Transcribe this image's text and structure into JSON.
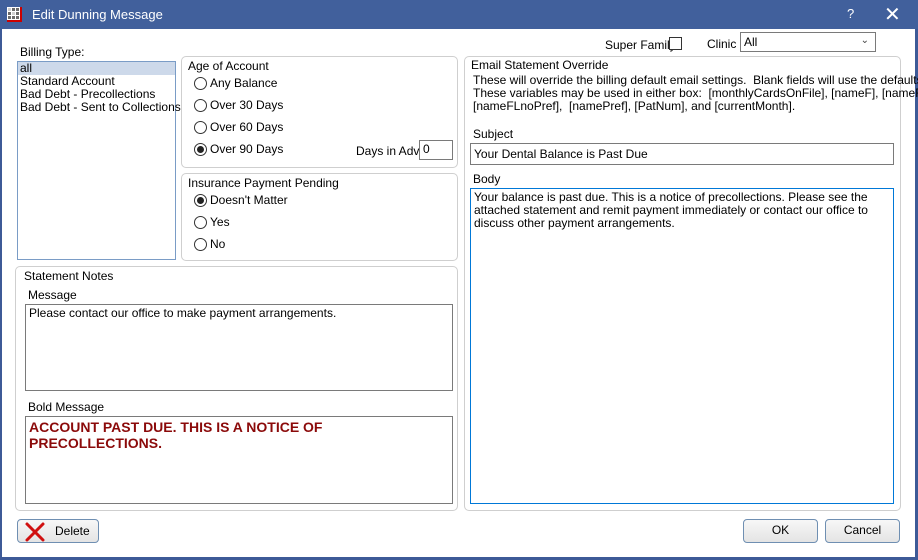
{
  "window": {
    "title": "Edit Dunning Message",
    "help_label": "?",
    "close_label": "✕"
  },
  "billing_type": {
    "label": "Billing Type:",
    "items": [
      "all",
      "Standard Account",
      "Bad Debt - Precollections",
      "Bad Debt - Sent to Collections"
    ],
    "selected": "all"
  },
  "age_of_account": {
    "title": "Age of Account",
    "options": [
      "Any Balance",
      "Over 30 Days",
      "Over 60 Days",
      "Over 90 Days"
    ],
    "selected": "Over 90 Days",
    "days_in_adv_label": "Days in Adv",
    "days_in_adv_value": "0"
  },
  "insurance_payment_pending": {
    "title": "Insurance Payment Pending",
    "options": [
      "Doesn't Matter",
      "Yes",
      "No"
    ],
    "selected": "Doesn't Matter"
  },
  "super_family": {
    "label": "Super Family",
    "checked": false
  },
  "clinic": {
    "label": "Clinic",
    "value": "All"
  },
  "email_override": {
    "title": "Email Statement Override",
    "description": "These will override the billing default email settings.  Blank fields will use the defaults.\nThese variables may be used in either box:  [monthlyCardsOnFile], [nameF], [nameFL],\n[nameFLnoPref],  [namePref], [PatNum], and [currentMonth].",
    "subject_label": "Subject",
    "subject_value": "Your Dental Balance is Past Due",
    "body_label": "Body",
    "body_value": "Your balance is past due. This is a notice of precollections. Please see the attached statement and remit payment immediately or contact our office to discuss other payment arrangements."
  },
  "statement_notes": {
    "title": "Statement Notes",
    "message_label": "Message",
    "message_value": "Please contact our office to make payment arrangements.",
    "bold_message_label": "Bold Message",
    "bold_message_value": "ACCOUNT PAST DUE. THIS IS A NOTICE OF\nPRECOLLECTIONS.",
    "bold_color": "#8b0a0a"
  },
  "buttons": {
    "delete": "Delete",
    "ok": "OK",
    "cancel": "Cancel"
  }
}
